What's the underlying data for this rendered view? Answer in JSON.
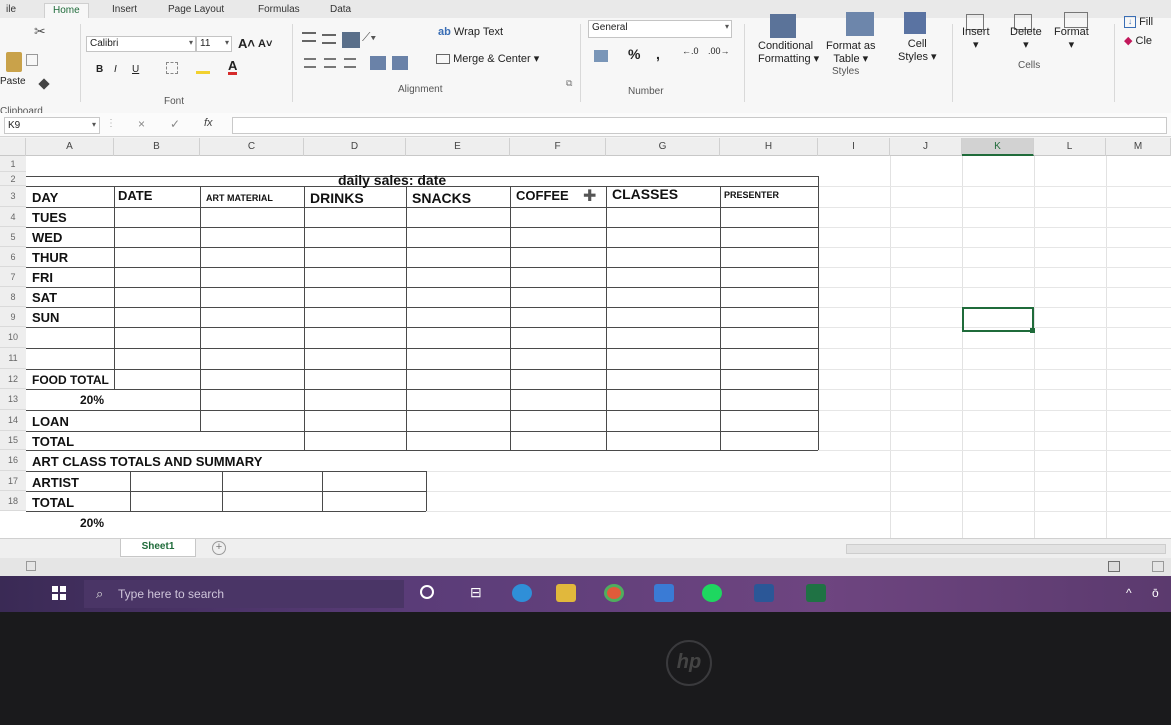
{
  "ribbon": {
    "tabs": [
      "ile",
      "Home",
      "Insert",
      "Page Layout",
      "Formulas",
      "Data"
    ],
    "clipboard": {
      "paste": "Paste",
      "label": "Clipboard"
    },
    "font": {
      "name": "Calibri",
      "size": "11",
      "label": "Font",
      "bold": "B",
      "italic": "I",
      "underline": "U"
    },
    "alignment": {
      "wrap_text": "Wrap Text",
      "merge_center": "Merge & Center",
      "label": "Alignment"
    },
    "number": {
      "format": "General",
      "percent": "%",
      "comma": ",",
      "label": "Number"
    },
    "styles": {
      "conditional": "Conditional",
      "formatting": "Formatting",
      "format_as": "Format as",
      "table": "Table",
      "cell": "Cell",
      "cell_styles": "Styles",
      "label": "Styles"
    },
    "cells": {
      "insert": "Insert",
      "delete": "Delete",
      "format": "Format",
      "label": "Cells"
    },
    "editing": {
      "fill": "Fill",
      "clear": "Cle"
    }
  },
  "formula_bar": {
    "name_box": "K9",
    "fx": "fx",
    "cancel": "×",
    "confirm": "✓"
  },
  "columns": [
    "A",
    "B",
    "C",
    "D",
    "E",
    "F",
    "G",
    "H",
    "I",
    "J",
    "K",
    "L",
    "M"
  ],
  "rows": [
    "1",
    "2",
    "3",
    "4",
    "5",
    "6",
    "7",
    "8",
    "9",
    "10",
    "11",
    "12",
    "13",
    "14",
    "15",
    "16",
    "17",
    "18"
  ],
  "sheet": {
    "title": "daily sales: date",
    "headers": {
      "day": "DAY",
      "date": "DATE",
      "art": "ART MATERIAL",
      "drinks": "DRINKS",
      "snacks": "SNACKS",
      "coffee": "COFFEE",
      "classes": "CLASSES",
      "presenter": "PRESENTER"
    },
    "days": [
      "TUES",
      "WED",
      "THUR",
      "FRI",
      "SAT",
      "SUN"
    ],
    "food_total": "FOOD TOTAL",
    "pct": "20%",
    "loan": "LOAN",
    "total": "TOTAL",
    "art_summary": "ART CLASS TOTALS AND SUMMARY",
    "artist": "ARTIST",
    "total2": "TOTAL",
    "partial": "20%"
  },
  "sheet_tab": "Sheet1",
  "add_sheet": "+",
  "taskbar": {
    "search_placeholder": "Type here to search"
  },
  "brand": "hp",
  "colors": {
    "excel_green": "#1f6b3a",
    "selection": "#1f6b3a"
  }
}
